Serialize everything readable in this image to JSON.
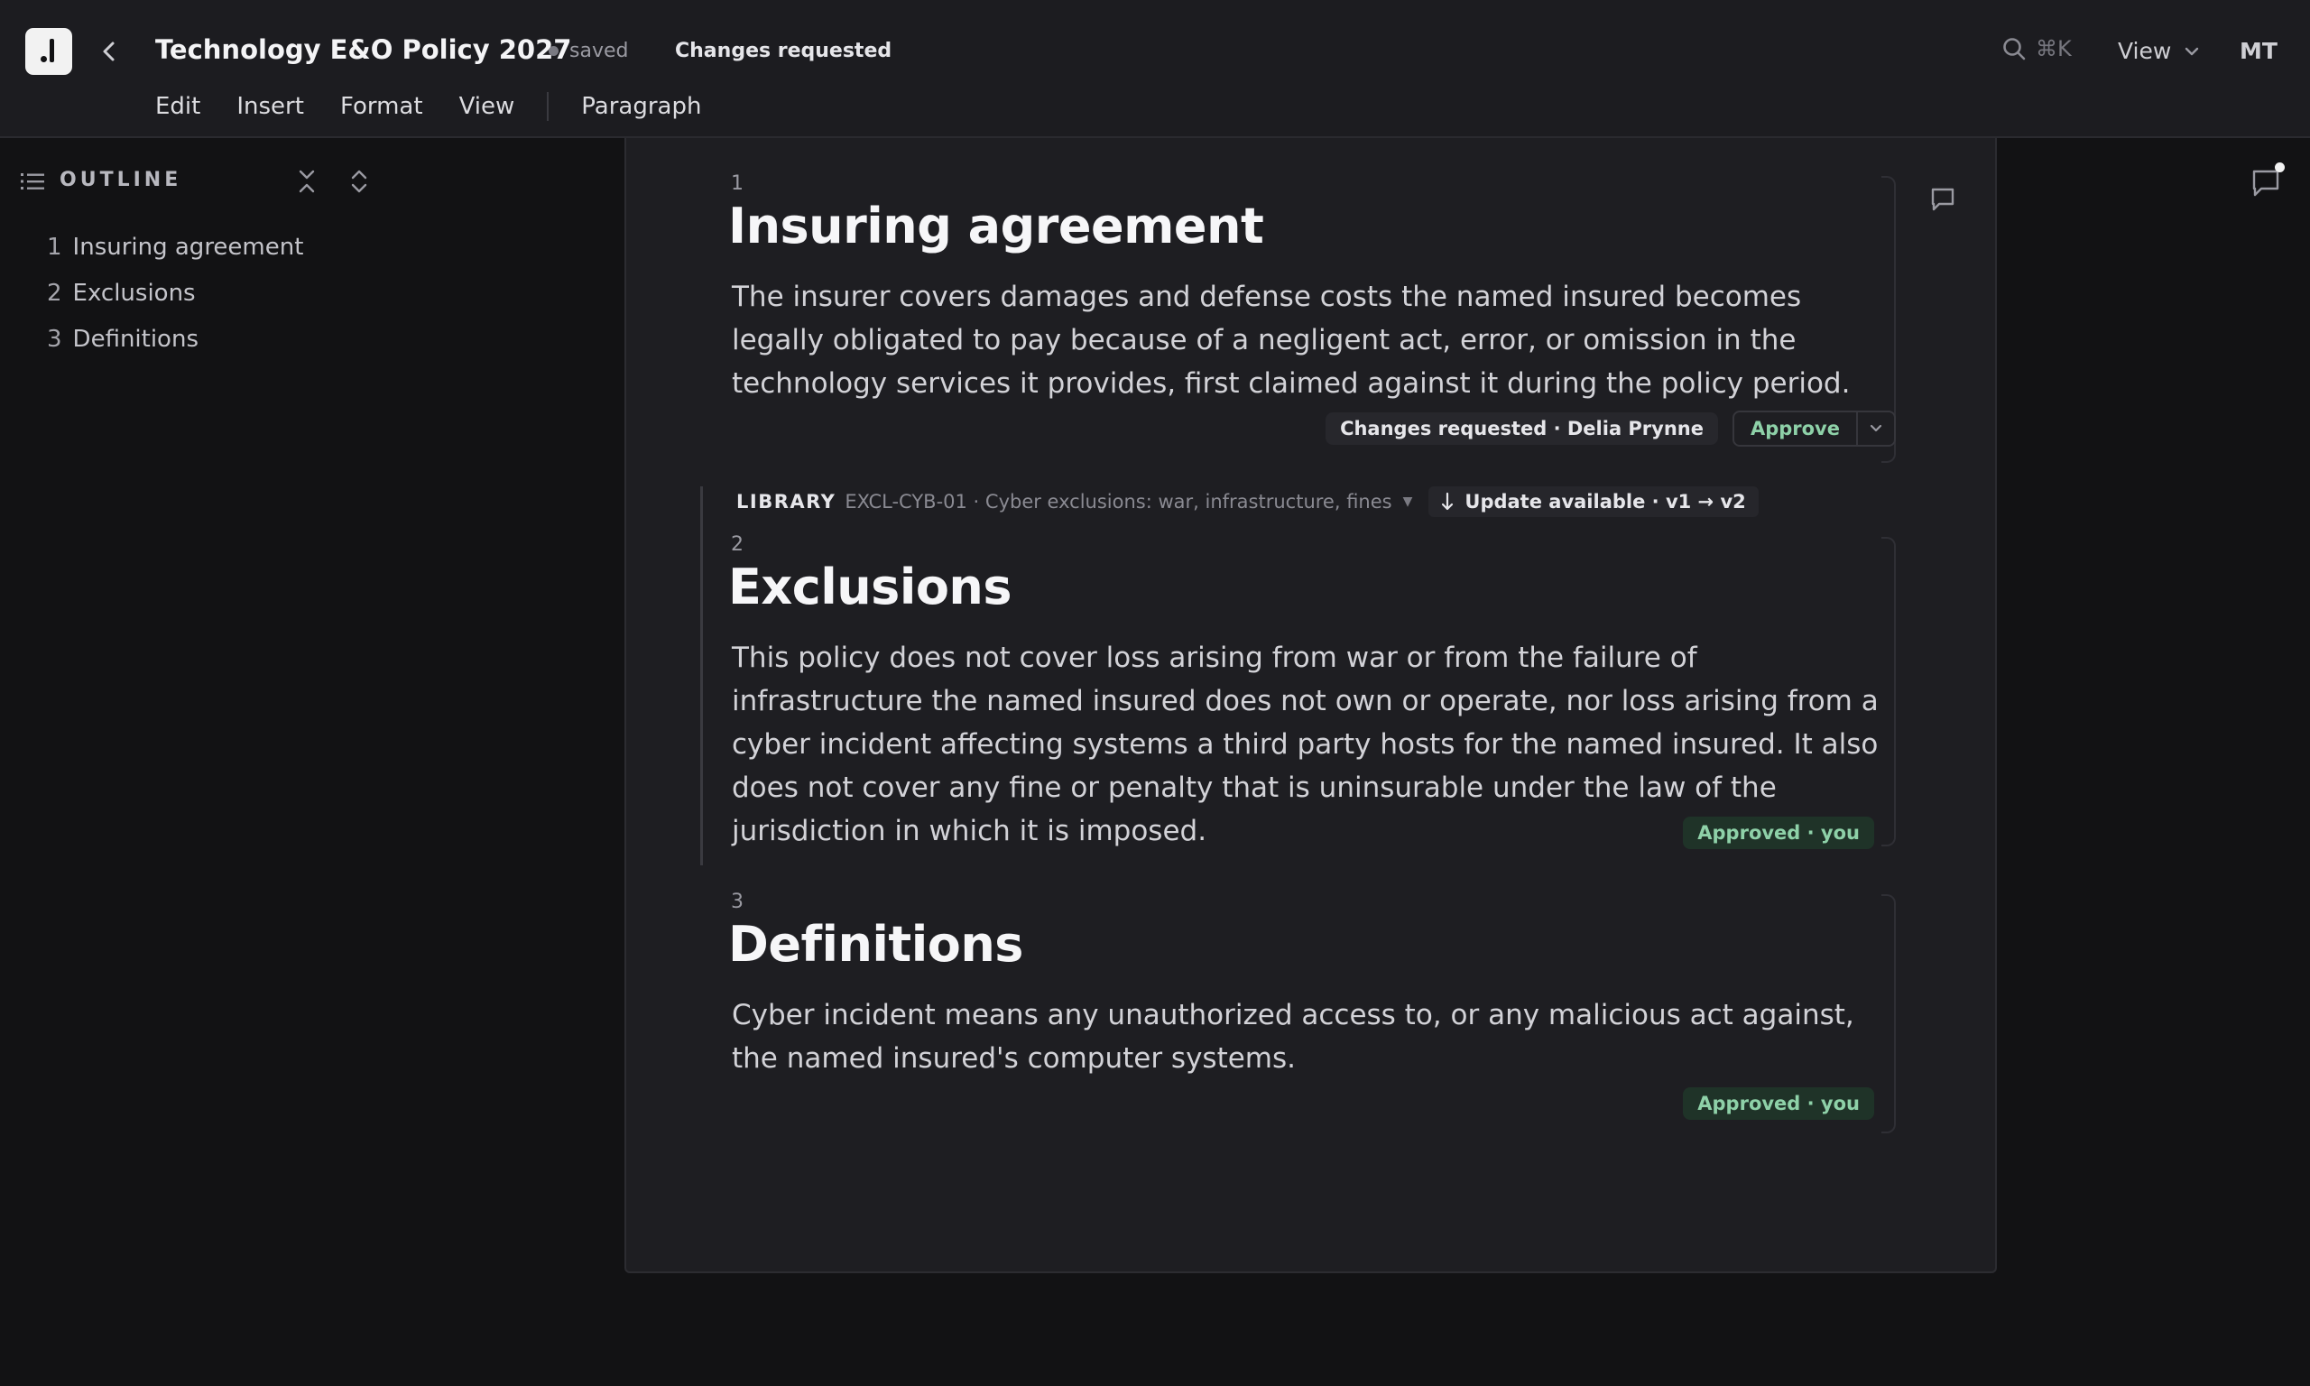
{
  "header": {
    "title": "Technology E&O Policy 2027",
    "save_status": "saved",
    "review_status": "Changes requested",
    "search_shortcut": "⌘K",
    "view_label": "View",
    "user_initials": "MT"
  },
  "menu": {
    "edit": "Edit",
    "insert": "Insert",
    "format": "Format",
    "view": "View",
    "block_type": "Paragraph"
  },
  "outline": {
    "title": "OUTLINE",
    "items": [
      {
        "num": "1",
        "label": "Insuring agreement"
      },
      {
        "num": "2",
        "label": "Exclusions"
      },
      {
        "num": "3",
        "label": "Definitions"
      }
    ]
  },
  "sections": [
    {
      "num": "1",
      "heading": "Insuring agreement",
      "body": "The insurer covers damages and defense costs the named insured becomes legally obligated to pay because of a negligent act, error, or omission in the technology services it provides, first claimed against it during the policy period.",
      "status": "Changes requested · Delia Prynne",
      "approve_label": "Approve"
    },
    {
      "num": "2",
      "heading": "Exclusions",
      "body": "This policy does not cover loss arising from war or from the failure of infrastructure the named insured does not own or operate, nor loss arising from a cyber incident affecting systems a third party hosts for the named insured. It also does not cover any fine or penalty that is uninsurable under the law of the jurisdiction in which it is imposed.",
      "status": "Approved · you",
      "library": {
        "tag": "LIBRARY",
        "ref": "EXCL-CYB-01 · Cyber exclusions: war, infrastructure, fines",
        "update": "Update available · v1 → v2"
      }
    },
    {
      "num": "3",
      "heading": "Definitions",
      "body": "Cyber incident means any unauthorized access to, or any malicious act against, the named insured's computer systems.",
      "status": "Approved · you"
    }
  ],
  "colors": {
    "background": "#121214",
    "page": "#1e1e22",
    "approved_text": "#8ed1a8",
    "approved_bg": "#1f3328"
  }
}
